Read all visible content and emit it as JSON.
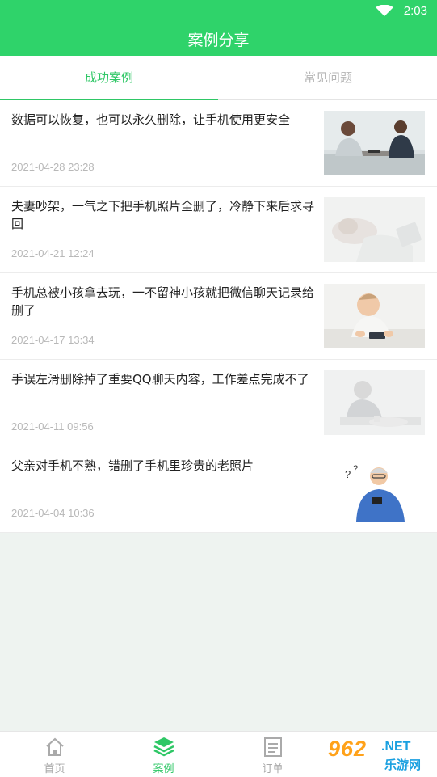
{
  "status_bar": {
    "time": "2:03"
  },
  "header": {
    "title": "案例分享"
  },
  "tabs": [
    {
      "label": "成功案例",
      "active": true
    },
    {
      "label": "常见问题",
      "active": false
    }
  ],
  "cases": [
    {
      "title": "数据可以恢复，也可以永久删除，让手机使用更安全",
      "date": "2021-04-28 23:28",
      "image": "couple-phone-photo"
    },
    {
      "title": "夫妻吵架，一气之下把手机照片全删了，冷静下来后求寻回",
      "date": "2021-04-21 12:24",
      "image": "sleeping-person-photo"
    },
    {
      "title": "手机总被小孩拿去玩，一不留神小孩就把微信聊天记录给删了",
      "date": "2021-04-17 13:34",
      "image": "baby-phone-photo"
    },
    {
      "title": "手误左滑删除掉了重要QQ聊天内容，工作差点完成不了",
      "date": "2021-04-11 09:56",
      "image": "tired-worker-photo"
    },
    {
      "title": "父亲对手机不熟，错删了手机里珍贵的老照片",
      "date": "2021-04-04 10:36",
      "image": "old-man-phone-illustration"
    }
  ],
  "bottom_nav": [
    {
      "label": "首页",
      "icon": "home-icon",
      "active": false
    },
    {
      "label": "案例",
      "icon": "layers-icon",
      "active": true
    },
    {
      "label": "订单",
      "icon": "order-icon",
      "active": false
    }
  ],
  "watermark": {
    "brand": "962",
    "net": ".NET",
    "sub": "乐游网"
  },
  "colors": {
    "primary": "#2fd36a",
    "accent_text": "#2fc766",
    "date_text": "#b8b8b8"
  }
}
